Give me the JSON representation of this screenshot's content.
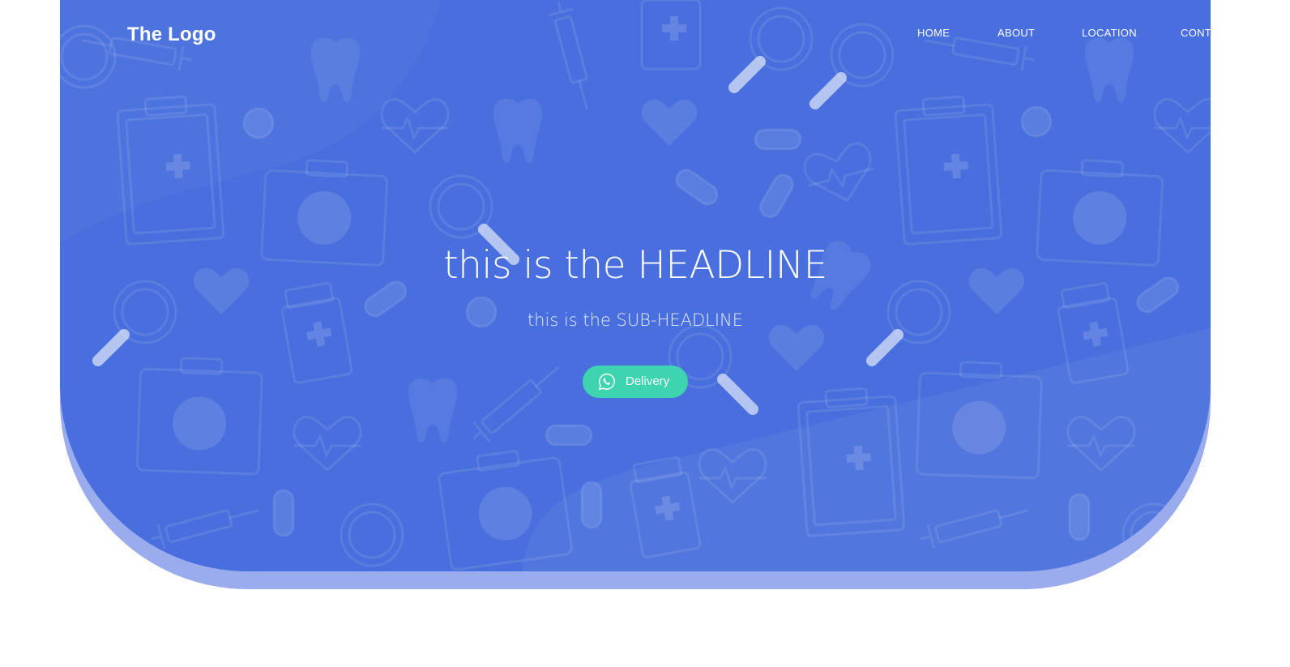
{
  "header": {
    "logo_text": "The Logo",
    "nav": [
      {
        "label": "HOME"
      },
      {
        "label": "ABOUT"
      },
      {
        "label": "LOCATION"
      },
      {
        "label": "CONTA"
      }
    ]
  },
  "hero": {
    "headline": "this is the HEADLINE",
    "subheadline": "this is the SUB-HEADLINE",
    "cta": {
      "label": "Delivery",
      "icon": "whatsapp-icon"
    },
    "background_icons": [
      "clipboard-icon",
      "first-aid-kit-icon",
      "tooth-icon",
      "heart-icon",
      "heartbeat-icon",
      "syringe-icon",
      "pill-capsule-icon",
      "pill-tablet-icon",
      "magnifier-icon",
      "medicine-bottle-icon"
    ]
  },
  "colors": {
    "hero_background": "#486fdd",
    "hero_shadow": "#9aaced",
    "cta_background": "#3ed4b0",
    "page_background": "#ffffff",
    "text": "#ffffff"
  }
}
